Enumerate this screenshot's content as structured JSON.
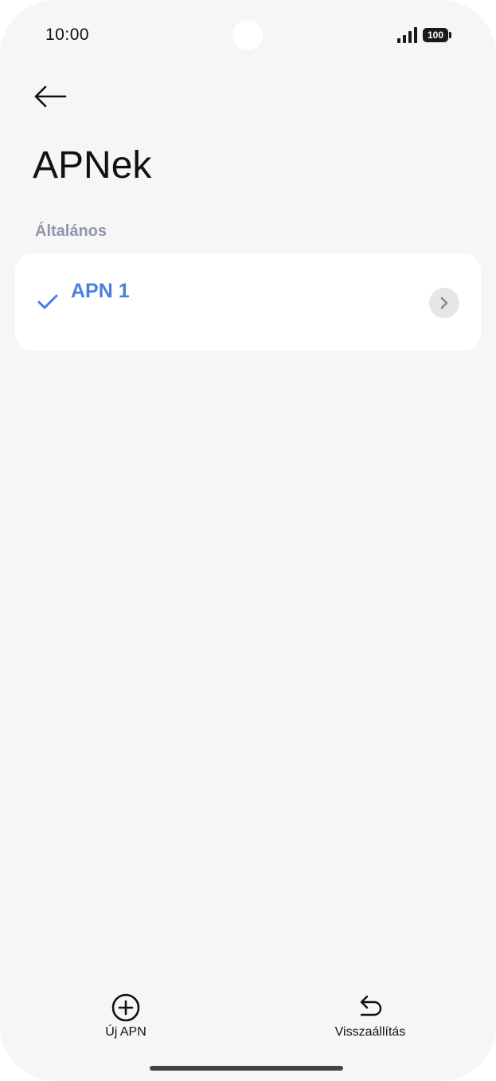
{
  "status_bar": {
    "time": "10:00",
    "battery_level": "100"
  },
  "header": {
    "back_icon": "arrow-left-icon",
    "title": "APNek"
  },
  "section": {
    "label": "Általános"
  },
  "apn_list": {
    "items": [
      {
        "label": "APN 1",
        "selected": true,
        "selected_icon": "checkmark-icon",
        "detail_icon": "chevron-right-icon"
      }
    ]
  },
  "bottom_bar": {
    "new_apn": {
      "label": "Új APN",
      "icon": "plus-circle-icon"
    },
    "reset": {
      "label": "Visszaállítás",
      "icon": "undo-arrow-icon"
    }
  },
  "colors": {
    "background": "#f6f6f6",
    "card": "#ffffff",
    "accent": "#4a7fe0",
    "section_header": "#8e96ab",
    "text": "#111111"
  }
}
